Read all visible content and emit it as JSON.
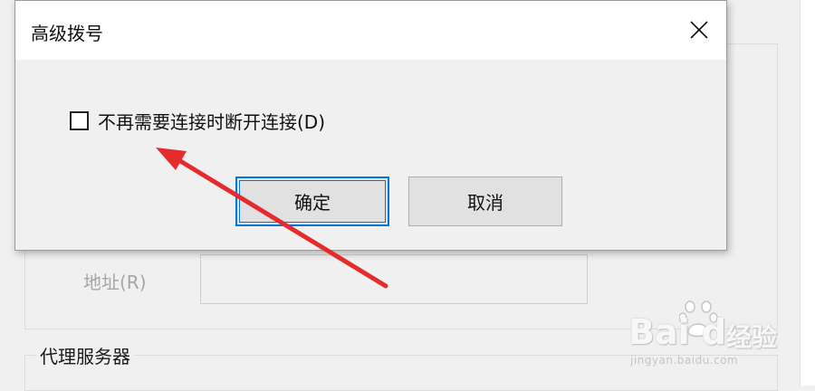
{
  "background_window": {
    "address_label": "地址(R)",
    "proxy_group_title": "代理服务器"
  },
  "dialog": {
    "title": "高级拨号",
    "close_icon": "close-icon",
    "checkbox": {
      "label": "不再需要连接时断开连接(D)",
      "checked": false
    },
    "ok_label": "确定",
    "cancel_label": "取消"
  },
  "annotation": {
    "arrow_color": "#e52b2b"
  },
  "watermark": {
    "brand": "Bai du",
    "brand_suffix": "经验",
    "url": "jingyan.baidu.com"
  },
  "colors": {
    "focus_blue": "#0078d7",
    "window_bg": "#f0f0f0",
    "titlebar_bg": "#ffffff"
  }
}
